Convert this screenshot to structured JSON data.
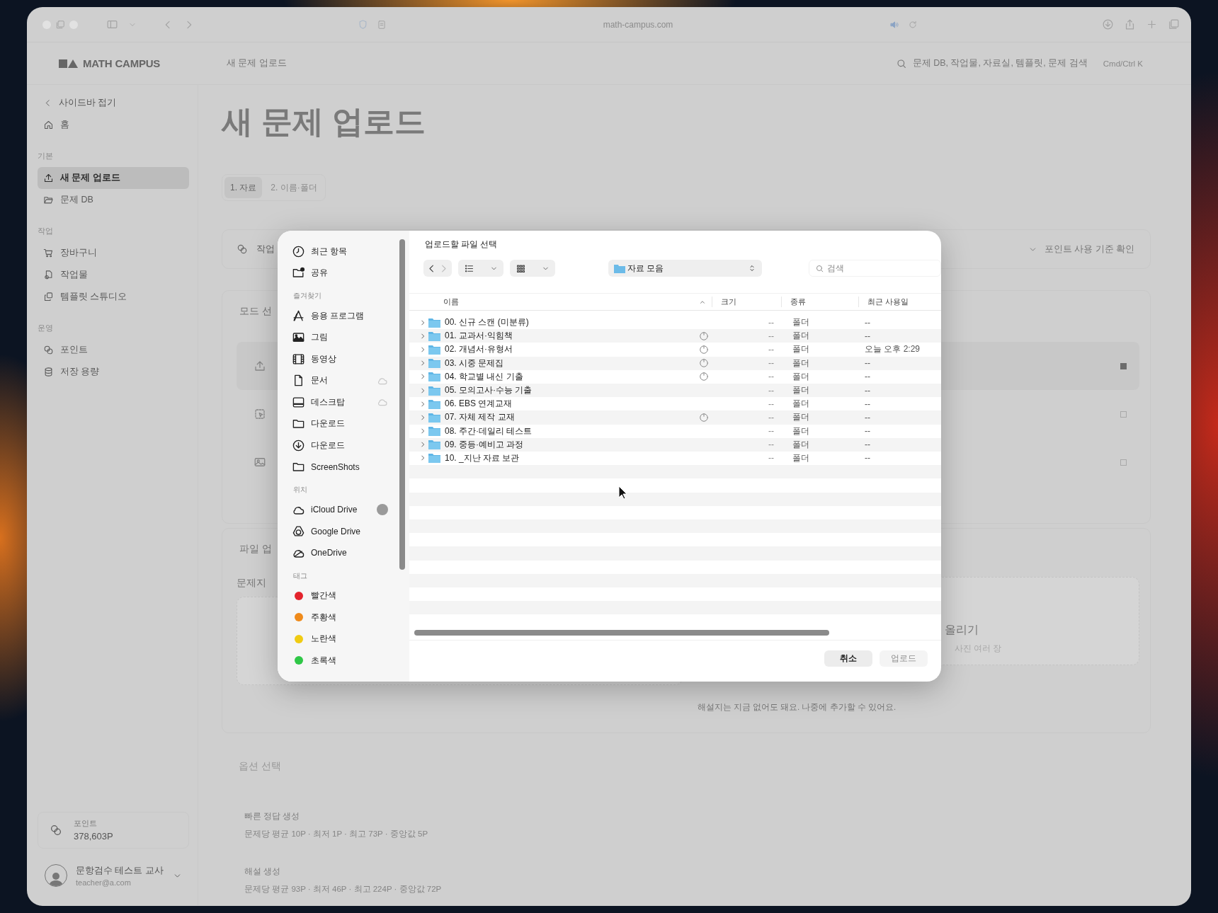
{
  "browser": {
    "url": "math-campus.com"
  },
  "header": {
    "logo": "MATH CAMPUS",
    "breadcrumb": "새 문제 업로드",
    "search_placeholder": "문제 DB, 작업물, 자료실, 템플릿, 문제 검색",
    "shortcut": "Cmd/Ctrl K"
  },
  "sidebar": {
    "collapse": "사이드바 접기",
    "home": {
      "label": "홈",
      "selected": false
    },
    "sections": [
      {
        "title": "기본",
        "items": [
          {
            "label": "새 문제 업로드",
            "selected": true
          },
          {
            "label": "문제 DB",
            "selected": false
          }
        ]
      },
      {
        "title": "작업",
        "items": [
          {
            "label": "장바구니",
            "selected": false
          },
          {
            "label": "작업물",
            "selected": false
          },
          {
            "label": "템플릿 스튜디오",
            "selected": false
          }
        ]
      },
      {
        "title": "운영",
        "items": [
          {
            "label": "포인트",
            "selected": false
          },
          {
            "label": "저장 용량",
            "selected": false
          }
        ]
      }
    ],
    "points": {
      "label": "포인트",
      "value": "378,603P"
    },
    "user": {
      "name": "문항검수 테스트 교사",
      "email": "teacher@a.com"
    }
  },
  "main": {
    "title": "새 문제 업로드",
    "steps": [
      {
        "label": "1. 자료",
        "selected": true
      },
      {
        "label": "2. 이름·폴더",
        "selected": false
      }
    ],
    "notice": {
      "label": "작업",
      "link": "포인트 사용 기준 확인"
    },
    "mode": {
      "title": "모드 선",
      "options": [
        {
          "selected": true
        },
        {
          "selected": false
        },
        {
          "selected": false
        }
      ]
    },
    "upload": {
      "title": "파일 업",
      "sheet_label": "문제지",
      "drop_title": "올리기",
      "drop_hint": "사진 여러 장",
      "note": "해설지는 지금 없어도 돼요. 나중에 추가할 수 있어요."
    },
    "options": {
      "title": "옵션 선택",
      "items": [
        {
          "name": "빠른 정답 생성",
          "stats": "문제당 평균 10P · 최저 1P · 최고 73P · 중앙값 5P"
        },
        {
          "name": "해설 생성",
          "stats": "문제당 평균 93P · 최저 46P · 최고 224P · 중앙값 72P"
        }
      ]
    }
  },
  "file_dialog": {
    "title": "업로드할 파일 선택",
    "path": "자료 모음",
    "search_placeholder": "검색",
    "sidebar": [
      {
        "items": [
          {
            "label": "최근 항목"
          },
          {
            "label": "공유"
          }
        ]
      },
      {
        "title": "즐겨찾기",
        "items": [
          {
            "label": "응용 프로그램",
            "in_cloud": false
          },
          {
            "label": "그림",
            "in_cloud": false
          },
          {
            "label": "동영상",
            "in_cloud": false
          },
          {
            "label": "문서",
            "in_cloud": true
          },
          {
            "label": "데스크탑",
            "in_cloud": true
          },
          {
            "label": "다운로드",
            "in_cloud": false
          },
          {
            "label": "다운로드",
            "in_cloud": false
          },
          {
            "label": "ScreenShots",
            "in_cloud": false
          }
        ]
      },
      {
        "title": "위치",
        "items": [
          {
            "label": "iCloud Drive",
            "syncing": true
          },
          {
            "label": "Google Drive",
            "syncing": false
          },
          {
            "label": "OneDrive",
            "syncing": false
          }
        ]
      },
      {
        "title": "태그",
        "items": [
          {
            "label": "빨간색",
            "color": "#e3232c"
          },
          {
            "label": "주황색",
            "color": "#ef8a1a"
          },
          {
            "label": "노란색",
            "color": "#f0cb12"
          },
          {
            "label": "초록색",
            "color": "#2fc747"
          }
        ]
      }
    ],
    "columns": [
      {
        "label": "이름",
        "sorted": true
      },
      {
        "label": "크기",
        "sorted": false
      },
      {
        "label": "종류",
        "sorted": false
      },
      {
        "label": "최근 사용일",
        "sorted": false
      }
    ],
    "rows": [
      {
        "name": "00. 신규 스캔 (미분류)",
        "pending": false,
        "size": "--",
        "kind": "폴더",
        "date": "--"
      },
      {
        "name": "01. 교과서·익힘책",
        "pending": true,
        "size": "--",
        "kind": "폴더",
        "date": "--"
      },
      {
        "name": "02. 개념서·유형서",
        "pending": true,
        "size": "--",
        "kind": "폴더",
        "date": "오늘 오후 2:29"
      },
      {
        "name": "03. 시중 문제집",
        "pending": true,
        "size": "--",
        "kind": "폴더",
        "date": "--"
      },
      {
        "name": "04. 학교별 내신 기출",
        "pending": true,
        "size": "--",
        "kind": "폴더",
        "date": "--"
      },
      {
        "name": "05. 모의고사·수능 기출",
        "pending": false,
        "size": "--",
        "kind": "폴더",
        "date": "--"
      },
      {
        "name": "06. EBS 연계교재",
        "pending": false,
        "size": "--",
        "kind": "폴더",
        "date": "--"
      },
      {
        "name": "07. 자체 제작 교재",
        "pending": true,
        "size": "--",
        "kind": "폴더",
        "date": "--"
      },
      {
        "name": "08. 주간·데일리 테스트",
        "pending": false,
        "size": "--",
        "kind": "폴더",
        "date": "--"
      },
      {
        "name": "09. 중등·예비고 과정",
        "pending": false,
        "size": "--",
        "kind": "폴더",
        "date": "--"
      },
      {
        "name": "10. _지난 자료 보관",
        "pending": false,
        "size": "--",
        "kind": "폴더",
        "date": "--"
      }
    ],
    "buttons": [
      {
        "label": "취소",
        "disabled": false
      },
      {
        "label": "업로드",
        "disabled": true
      }
    ]
  }
}
